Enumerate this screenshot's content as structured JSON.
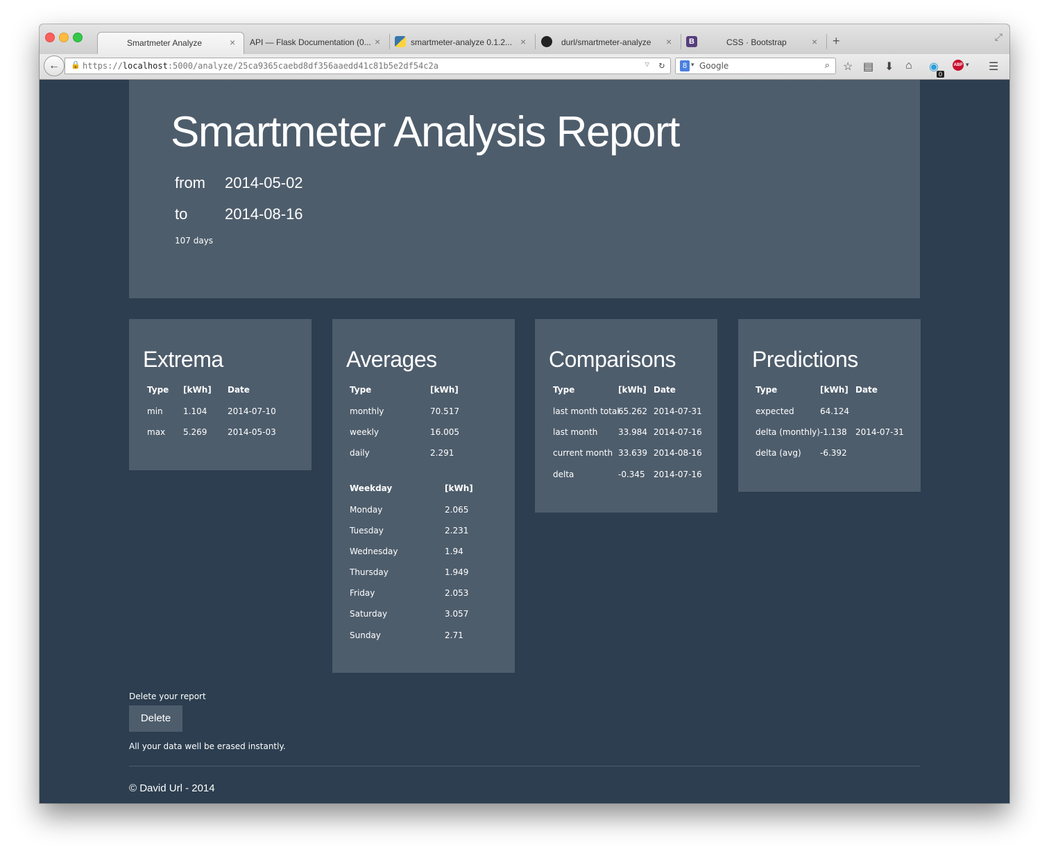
{
  "browser": {
    "tabs": [
      {
        "label": "Smartmeter Analyze",
        "active": true
      },
      {
        "label": "API — Flask Documentation (0...",
        "active": false
      },
      {
        "label": "smartmeter-analyze 0.1.2...",
        "active": false
      },
      {
        "label": "durl/smartmeter-analyze",
        "active": false
      },
      {
        "label": "CSS · Bootstrap",
        "active": false
      }
    ],
    "new_tab": "+",
    "url_prefix": "https://",
    "url_host": "localhost",
    "url_rest": ":5000/analyze/25ca9365caebd8df356aaedd41c81b5e2df54c2a",
    "search_engine": "Google",
    "ghostery_count": "0",
    "bootstrap_favicon": "B",
    "abp_label": "ABP",
    "google_label": "8"
  },
  "report": {
    "title": "Smartmeter Analysis Report",
    "from_label": "from",
    "from_date": "2014-05-02",
    "to_label": "to",
    "to_date": "2014-08-16",
    "days": "107 days"
  },
  "extrema": {
    "title": "Extrema",
    "headers": [
      "Type",
      "[kWh]",
      "Date"
    ],
    "rows": [
      [
        "min",
        "1.104",
        "2014-07-10"
      ],
      [
        "max",
        "5.269",
        "2014-05-03"
      ]
    ]
  },
  "averages": {
    "title": "Averages",
    "headers": [
      "Type",
      "[kWh]"
    ],
    "rows": [
      [
        "monthly",
        "70.517"
      ],
      [
        "weekly",
        "16.005"
      ],
      [
        "daily",
        "2.291"
      ]
    ],
    "weekday_headers": [
      "Weekday",
      "[kWh]"
    ],
    "weekday_rows": [
      [
        "Monday",
        "2.065"
      ],
      [
        "Tuesday",
        "2.231"
      ],
      [
        "Wednesday",
        "1.94"
      ],
      [
        "Thursday",
        "1.949"
      ],
      [
        "Friday",
        "2.053"
      ],
      [
        "Saturday",
        "3.057"
      ],
      [
        "Sunday",
        "2.71"
      ]
    ]
  },
  "comparisons": {
    "title": "Comparisons",
    "headers": [
      "Type",
      "[kWh]",
      "Date"
    ],
    "rows": [
      [
        "last month total",
        "65.262",
        "2014-07-31"
      ],
      [
        "last month",
        "33.984",
        "2014-07-16"
      ],
      [
        "current month",
        "33.639",
        "2014-08-16"
      ],
      [
        "delta",
        "-0.345",
        "2014-07-16"
      ]
    ]
  },
  "predictions": {
    "title": "Predictions",
    "headers": [
      "Type",
      "[kWh]",
      "Date"
    ],
    "rows": [
      [
        "expected",
        "64.124",
        ""
      ],
      [
        "delta (monthly)",
        "-1.138",
        "2014-07-31"
      ],
      [
        "delta (avg)",
        "-6.392",
        ""
      ]
    ]
  },
  "delete": {
    "label": "Delete your report",
    "button": "Delete",
    "note": "All your data well be erased instantly."
  },
  "footer": {
    "text": "© David Url - 2014"
  }
}
